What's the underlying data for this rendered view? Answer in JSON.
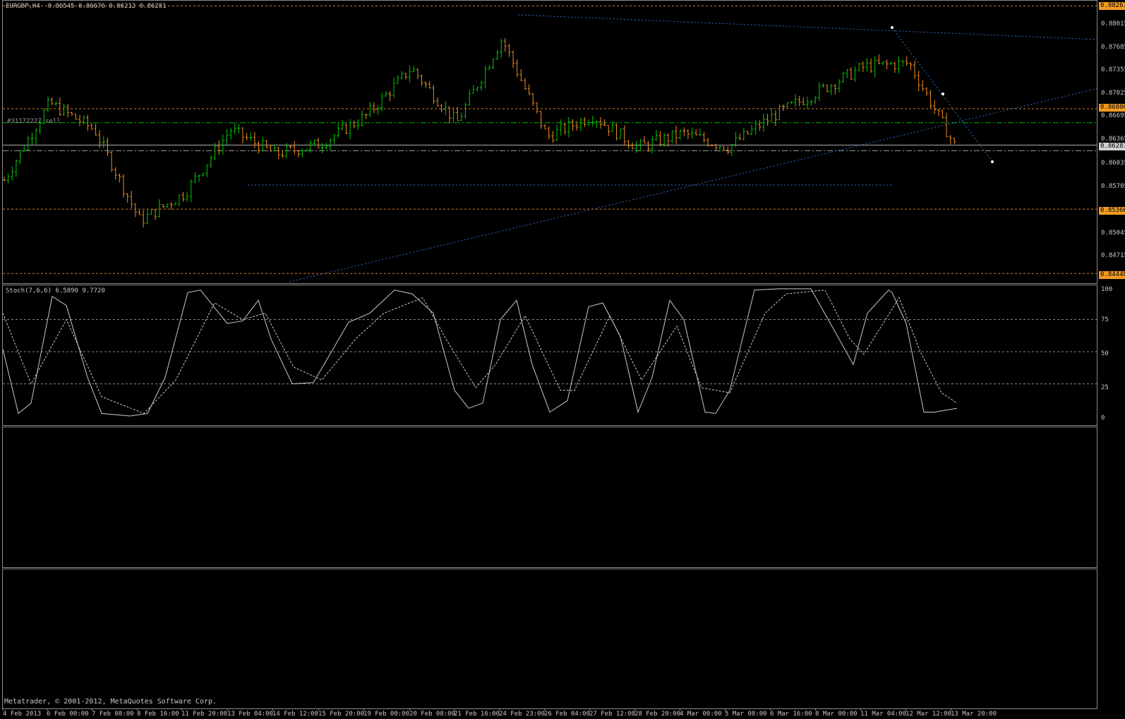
{
  "chart": {
    "title": "EURGBP,H4  0.86545 0.86676 0.86212 0.86281",
    "order_label": "#31172227 sell",
    "copyright": "Metatrader, © 2001-2012, MetaQuotes Software Corp.",
    "price_axis": [
      "0.88015",
      "0.87685",
      "0.87355",
      "0.87025",
      "0.86695",
      "0.86365",
      "0.86035",
      "0.85705",
      "0.85045",
      "0.84715"
    ],
    "price_tags": {
      "top": "0.88267",
      "upper": "0.86800",
      "current": "0.86281",
      "lower": "0.85366",
      "bottom": "0.84448"
    },
    "time_axis": [
      "4 Feb 2013",
      "6 Feb 00:00",
      "7 Feb 08:00",
      "8 Feb 16:00",
      "11 Feb 20:00",
      "13 Feb 04:00",
      "14 Feb 12:00",
      "15 Feb 20:00",
      "19 Feb 00:00",
      "20 Feb 08:00",
      "21 Feb 16:00",
      "24 Feb 23:00",
      "26 Feb 04:00",
      "27 Feb 12:00",
      "28 Feb 20:00",
      "4 Mar 00:00",
      "5 Mar 08:00",
      "6 Mar 16:00",
      "8 Mar 00:00",
      "11 Mar 04:00",
      "12 Mar 12:00",
      "13 Mar 20:00"
    ],
    "colors": {
      "bull": "#00c800",
      "bear": "#f08c1e",
      "trend": "#2f6fc8",
      "level": "#e07a1e",
      "signal": "#00b400"
    }
  },
  "stoch": {
    "title": "Stoch(7,6,6) 6.5890 9.7720",
    "levels": [
      "100",
      "75",
      "50",
      "25",
      "0"
    ]
  },
  "chart_data": {
    "type": "line",
    "title": "EURGBP,H4",
    "x": [
      "4 Feb 2013",
      "6 Feb 00:00",
      "7 Feb 08:00",
      "8 Feb 16:00",
      "11 Feb 20:00",
      "13 Feb 04:00",
      "14 Feb 12:00",
      "15 Feb 20:00",
      "19 Feb 00:00",
      "20 Feb 08:00",
      "21 Feb 16:00",
      "24 Feb 23:00",
      "26 Feb 04:00",
      "27 Feb 12:00",
      "28 Feb 20:00",
      "4 Mar 00:00",
      "5 Mar 08:00",
      "6 Mar 16:00",
      "8 Mar 00:00",
      "11 Mar 04:00",
      "12 Mar 12:00",
      "13 Mar 20:00"
    ],
    "ylim": [
      0.8437,
      0.883
    ],
    "series": [
      {
        "name": "EURGBP",
        "values": [
          0.8578,
          0.8688,
          0.865,
          0.852,
          0.856,
          0.865,
          0.8615,
          0.863,
          0.867,
          0.8738,
          0.866,
          0.878,
          0.864,
          0.867,
          0.8625,
          0.8645,
          0.8625,
          0.867,
          0.8705,
          0.874,
          0.8745,
          0.8628
        ]
      }
    ]
  }
}
